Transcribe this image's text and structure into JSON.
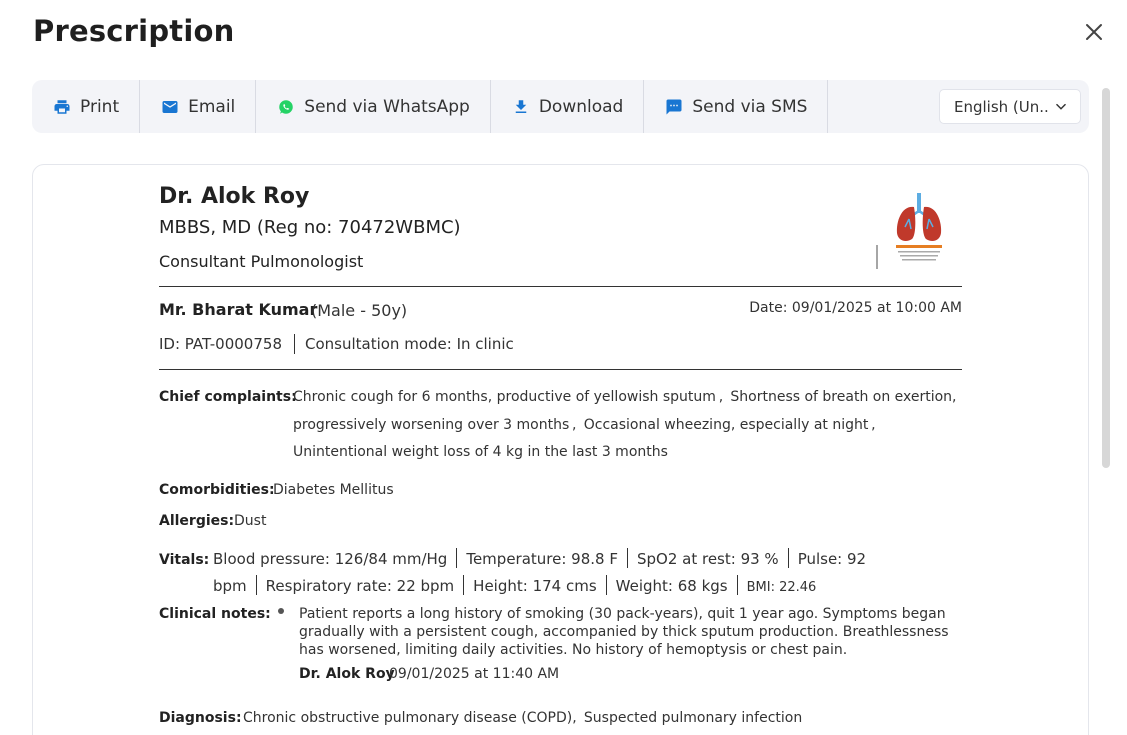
{
  "modal": {
    "title": "Prescription",
    "close_icon": "close-icon"
  },
  "toolbar": {
    "print": {
      "label": "Print",
      "icon": "printer-icon"
    },
    "email": {
      "label": "Email",
      "icon": "mail-icon"
    },
    "whatsapp": {
      "label": "Send via WhatsApp",
      "icon": "whatsapp-icon"
    },
    "download": {
      "label": "Download",
      "icon": "download-icon"
    },
    "sms": {
      "label": "Send via SMS",
      "icon": "sms-icon"
    },
    "language": {
      "selected": "English (Un...",
      "icon": "chevron-down-icon"
    }
  },
  "doctor": {
    "name": "Dr. Alok Roy",
    "qualification": "MBBS, MD (Reg no: 70472WBMC)",
    "specialty": "Consultant Pulmonologist"
  },
  "patient": {
    "name": "Mr. Bharat Kumar",
    "meta": "(Male - 50y)",
    "date": "Date: 09/01/2025 at 10:00 AM",
    "id": "ID: PAT-0000758",
    "consultation_mode": "Consultation mode: In clinic"
  },
  "sections": {
    "chief_complaints_label": "Chief complaints:",
    "chief_complaints": "Chronic cough for 6 months, productive of yellowish sputum ,  Shortness of breath on exertion, progressively worsening over 3 months ,  Occasional wheezing, especially at night ,  Unintentional weight loss of 4 kg in the last 3 months",
    "comorbidities_label": "Comorbidities:",
    "comorbidities": "Diabetes Mellitus",
    "allergies_label": "Allergies:",
    "allergies": "Dust",
    "vitals_label": "Vitals:",
    "vitals": [
      "Blood pressure: 126/84 mm/Hg",
      "Temperature: 98.8 F",
      "SpO2 at rest: 93 %",
      "Pulse: 92 bpm",
      "Respiratory rate: 22 bpm",
      "Height: 174 cms",
      "Weight: 68 kgs",
      "BMI: 22.46"
    ],
    "clinical_notes_label": "Clinical notes:",
    "clinical_note": "Patient reports a long history of smoking (30 pack-years), quit 1 year ago. Symptoms began gradually with a persistent cough, accompanied by thick sputum production. Breathlessness has worsened, limiting daily activities. No history of hemoptysis or chest pain.",
    "clinical_note_author": "Dr. Alok Roy",
    "clinical_note_time": "09/01/2025 at 11:40 AM",
    "diagnosis_label": "Diagnosis:",
    "diagnosis": "Chronic obstructive pulmonary disease (COPD),  Suspected pulmonary infection"
  },
  "colors": {
    "accent": "#1976d2",
    "whatsapp": "#25d366",
    "logo_lung": "#c0392b"
  }
}
